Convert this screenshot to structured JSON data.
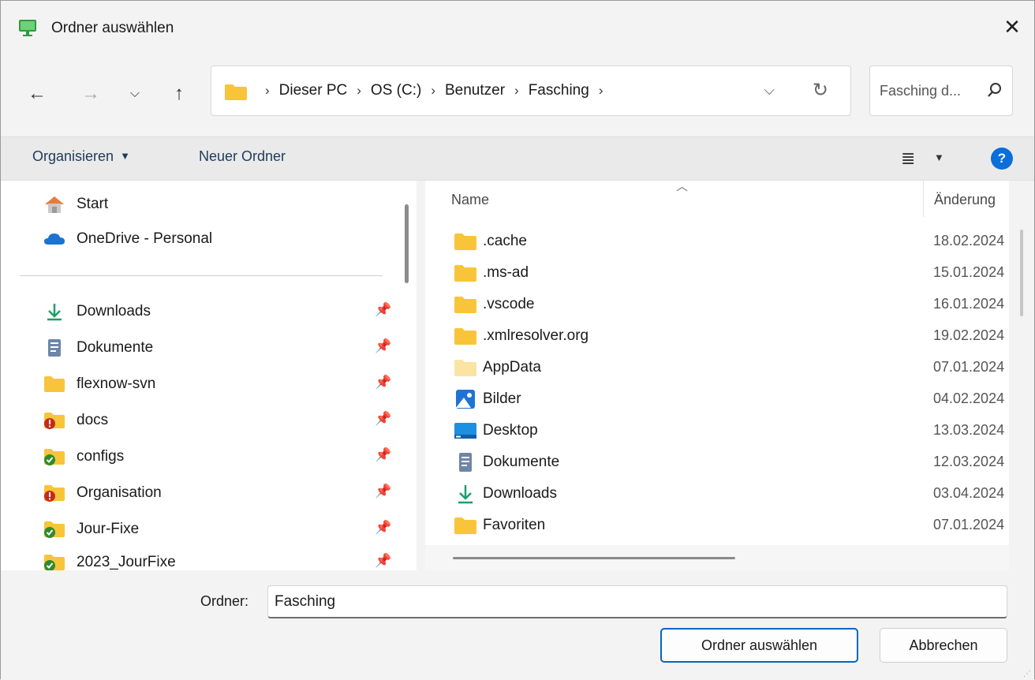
{
  "window": {
    "title": "Ordner auswählen"
  },
  "address": {
    "crumbs": [
      "Dieser PC",
      "OS (C:)",
      "Benutzer",
      "Fasching"
    ],
    "sep": "›"
  },
  "search": {
    "placeholder": "Fasching d..."
  },
  "toolbar": {
    "organize": "Organisieren",
    "new_folder": "Neuer Ordner",
    "help": "?"
  },
  "nav": {
    "quick": [
      {
        "label": "Start",
        "icon": "home-icon"
      },
      {
        "label": "OneDrive - Personal",
        "icon": "cloud-icon"
      }
    ],
    "pinned": [
      {
        "label": "Downloads",
        "icon": "download-icon"
      },
      {
        "label": "Dokumente",
        "icon": "document-icon"
      },
      {
        "label": "flexnow-svn",
        "icon": "folder-icon"
      },
      {
        "label": "docs",
        "icon": "folder-error-icon"
      },
      {
        "label": "configs",
        "icon": "folder-synced-icon"
      },
      {
        "label": "Organisation",
        "icon": "folder-error-icon"
      },
      {
        "label": "Jour-Fixe",
        "icon": "folder-synced-icon"
      },
      {
        "label": "2023_JourFixe",
        "icon": "folder-synced-icon"
      }
    ]
  },
  "files": {
    "columns": {
      "name": "Name",
      "date": "Änderung"
    },
    "rows": [
      {
        "name": ".cache",
        "date": "18.02.2024",
        "icon": "folder-icon"
      },
      {
        "name": ".ms-ad",
        "date": "15.01.2024",
        "icon": "folder-icon"
      },
      {
        "name": ".vscode",
        "date": "16.01.2024",
        "icon": "folder-icon"
      },
      {
        "name": ".xmlresolver.org",
        "date": "19.02.2024",
        "icon": "folder-icon"
      },
      {
        "name": "AppData",
        "date": "07.01.2024",
        "icon": "folder-hidden-icon"
      },
      {
        "name": "Bilder",
        "date": "04.02.2024",
        "icon": "pictures-icon"
      },
      {
        "name": "Desktop",
        "date": "13.03.2024",
        "icon": "desktop-icon"
      },
      {
        "name": "Dokumente",
        "date": "12.03.2024",
        "icon": "document-icon"
      },
      {
        "name": "Downloads",
        "date": "03.04.2024",
        "icon": "download-icon"
      },
      {
        "name": "Favoriten",
        "date": "07.01.2024",
        "icon": "folder-icon"
      }
    ]
  },
  "footer": {
    "folder_label": "Ordner:",
    "folder_value": "Fasching",
    "select_button": "Ordner auswählen",
    "cancel_button": "Abbrechen"
  },
  "colors": {
    "folder": "#f8c43a",
    "accent": "#0067c0",
    "help": "#0a6fd8"
  }
}
